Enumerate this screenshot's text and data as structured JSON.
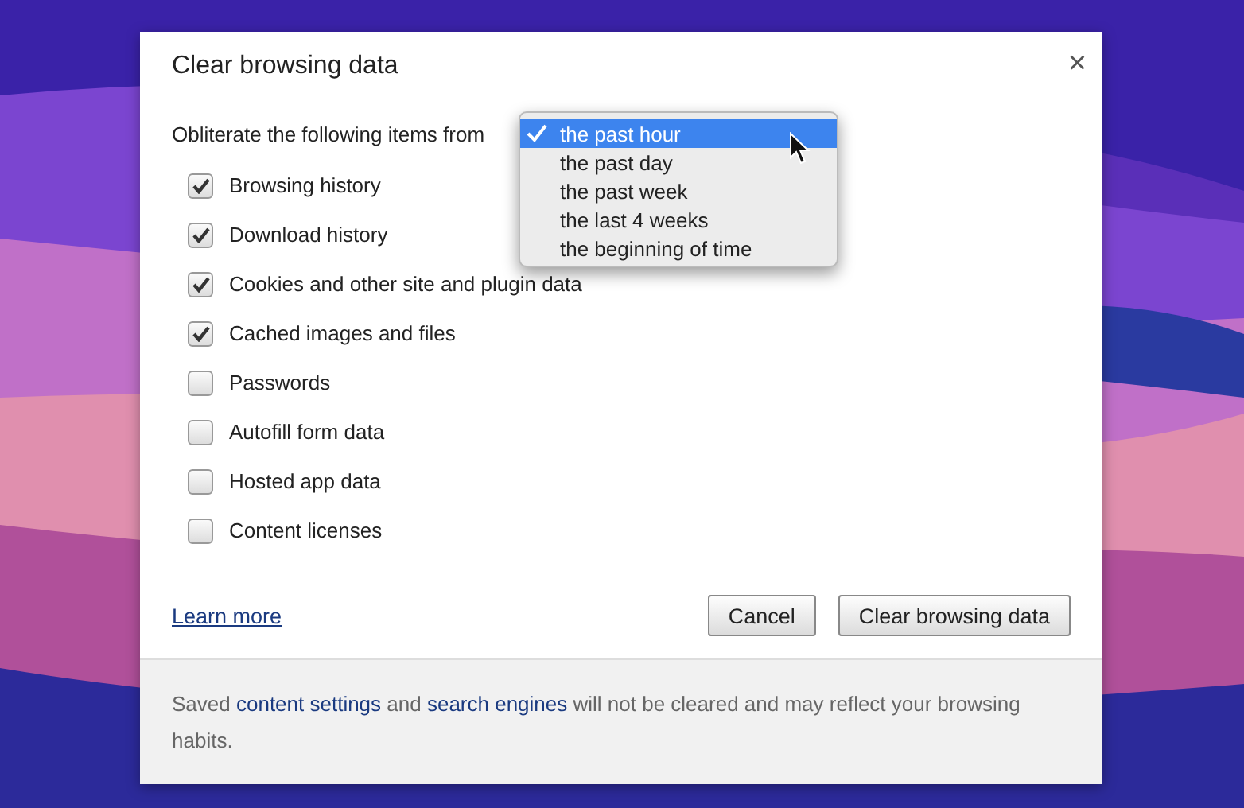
{
  "dialog": {
    "title": "Clear browsing data",
    "close": "×",
    "prompt": "Obliterate the following items from",
    "period_menu": [
      {
        "label": "the past hour",
        "selected": true
      },
      {
        "label": "the past day",
        "selected": false
      },
      {
        "label": "the past week",
        "selected": false
      },
      {
        "label": "the last 4 weeks",
        "selected": false
      },
      {
        "label": "the beginning of time",
        "selected": false
      }
    ],
    "items": [
      {
        "label": "Browsing history",
        "checked": true
      },
      {
        "label": "Download history",
        "checked": true
      },
      {
        "label": "Cookies and other site and plugin data",
        "checked": true
      },
      {
        "label": "Cached images and files",
        "checked": true
      },
      {
        "label": "Passwords",
        "checked": false
      },
      {
        "label": "Autofill form data",
        "checked": false
      },
      {
        "label": "Hosted app data",
        "checked": false
      },
      {
        "label": "Content licenses",
        "checked": false
      }
    ],
    "learn_more": "Learn more",
    "buttons": [
      "Cancel",
      "Clear browsing data"
    ],
    "footer": [
      {
        "kind": "text",
        "text": "Saved "
      },
      {
        "kind": "link",
        "text": "content settings"
      },
      {
        "kind": "text",
        "text": " and "
      },
      {
        "kind": "link",
        "text": "search engines"
      },
      {
        "kind": "text",
        "text": " will not be cleared and may reflect your browsing habits."
      }
    ]
  }
}
